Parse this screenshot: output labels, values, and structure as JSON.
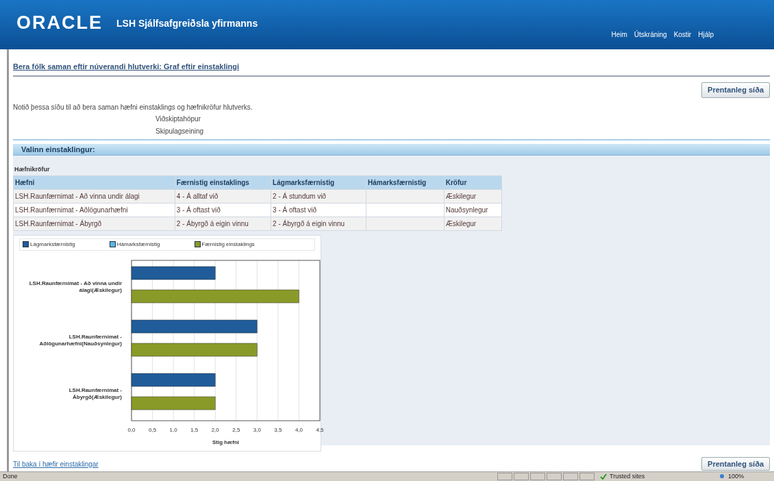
{
  "header": {
    "logo": "ORACLE",
    "app_title": "LSH Sjálfsafgreiðsla yfirmanns",
    "links": [
      "Heim",
      "Útskráning",
      "Kostir",
      "Hjálp"
    ]
  },
  "page": {
    "title": "Bera fólk saman eftir núverandi hlutverki: Graf eftir einstaklingi",
    "print_button": "Prentanleg síða",
    "description": "Notið þessa síðu til að bera saman hæfni einstaklings og hæfnikröfur hlutverks.",
    "info_lines": [
      "Viðskiptahópur",
      "Skipulagseining"
    ]
  },
  "section": {
    "title": "Valinn einstaklingur:",
    "table_caption": "Hæfnikröfur",
    "table": {
      "columns": [
        "Hæfni",
        "Færnistig einstaklings",
        "Lágmarksfærnistig",
        "Hámarksfærnistig",
        "Kröfur"
      ],
      "rows": [
        [
          "LSH.Raunfærnimat - Að vinna undir álagi",
          "4 - Á alltaf við",
          "2 - Á stundum við",
          "",
          "Æskilegur"
        ],
        [
          "LSH.Raunfærnimat - Aðlögunarhæfni",
          "3 - Á oftast við",
          "3 - Á oftast við",
          "",
          "Nauðsynlegur"
        ],
        [
          "LSH.Raunfærnimat - Ábyrgð",
          "2 - Ábyrgð á eigin vinnu",
          "2 - Ábyrgð á eigin vinnu",
          "",
          "Æskilegur"
        ]
      ]
    },
    "chart_data": {
      "type": "bar",
      "orientation": "horizontal",
      "grid": true,
      "legend": true,
      "xlabel": "Stig hæfni",
      "categories": [
        "LSH.Raunfærnimat - Að vinna undir álagi(Æskilegur)",
        "LSH.Raunfærnimat - Aðlögunarhæfni(Nauðsynlegur)",
        "LSH.Raunfærnimat - Ábyrgð(Æskilegur)"
      ],
      "series": [
        {
          "name": "Lágmarksfærnistig",
          "color": "#1f5c99",
          "values": [
            2,
            3,
            2
          ]
        },
        {
          "name": "Hámarksfærnistig",
          "color": "#5ab4e6",
          "values": [
            null,
            null,
            null
          ]
        },
        {
          "name": "Færnistig einstaklings",
          "color": "#8a9a28",
          "values": [
            4,
            3,
            2
          ]
        }
      ],
      "xlim": [
        0,
        4.5
      ],
      "xticks": [
        {
          "value": 0,
          "label": "0,0"
        },
        {
          "value": 0.5,
          "label": "0,5"
        },
        {
          "value": 1,
          "label": "1,0"
        },
        {
          "value": 1.5,
          "label": "1,5"
        },
        {
          "value": 2,
          "label": "2,0"
        },
        {
          "value": 2.5,
          "label": "2,5"
        },
        {
          "value": 3,
          "label": "3,0"
        },
        {
          "value": 3.5,
          "label": "3,5"
        },
        {
          "value": 4,
          "label": "4,0"
        },
        {
          "value": 4.5,
          "label": "4,5"
        }
      ]
    }
  },
  "footer": {
    "back_link": "Til baka í hæfir einstaklingar",
    "print_button": "Prentanleg síða"
  },
  "status_bar": {
    "status": "Done",
    "zone": "Trusted sites",
    "zoom": "100%"
  }
}
